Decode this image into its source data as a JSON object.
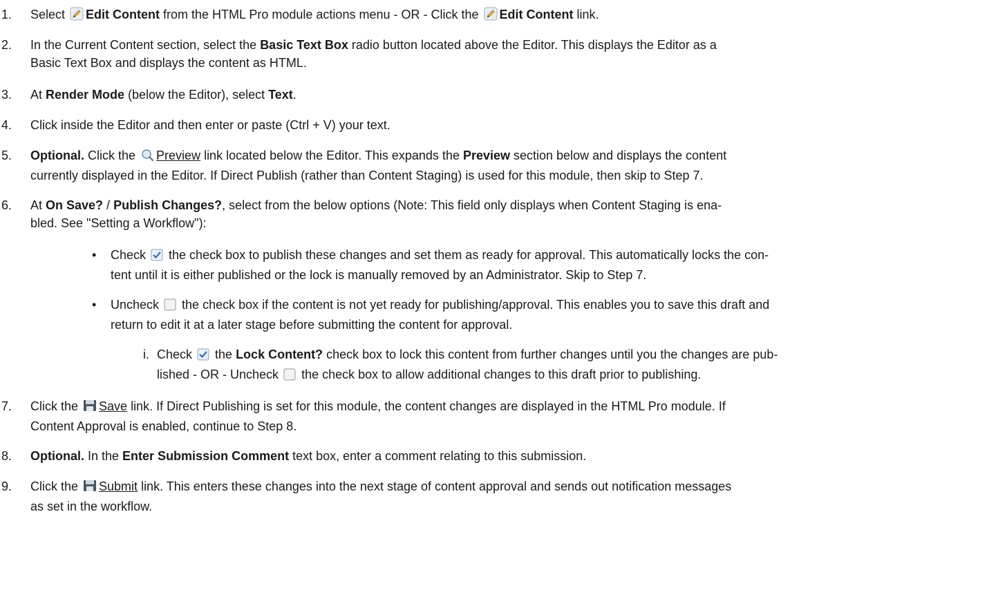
{
  "icons": {
    "edit": "pencil-edit-icon",
    "preview": "magnifier-icon",
    "checked": "checked-checkbox-icon",
    "unchecked": "unchecked-checkbox-icon",
    "save": "floppy-save-icon"
  },
  "steps": [
    {
      "num": "1.",
      "a": "Select ",
      "b": "Edit Content",
      "c": " from the HTML Pro module actions menu - OR - Click the ",
      "d": "Edit Content",
      "e": " link."
    },
    {
      "num": "2.",
      "a": "In the Current Content section, select the ",
      "b": "Basic Text Box",
      "c": " radio button located above the Editor. This displays the Editor as a",
      "line2": "Basic Text Box and displays the content as HTML."
    },
    {
      "num": "3.",
      "a": "At ",
      "b": "Render Mode",
      "c": " (below the Editor), select ",
      "d": "Text",
      "e": "."
    },
    {
      "num": "4.",
      "a": "Click inside the Editor and then enter or paste (Ctrl + V) your text."
    },
    {
      "num": "5.",
      "a": "Optional.",
      "b": " Click the ",
      "link": "Preview",
      "c": " link located below the Editor. This expands the ",
      "d": "Preview",
      "e": " section below and displays the content",
      "line2": "currently displayed in the Editor. If Direct Publish (rather than Content Staging) is used for this module, then skip to Step 7."
    },
    {
      "num": "6.",
      "a": "At ",
      "b": "On Save?",
      "c": " / ",
      "d": "Publish Changes?",
      "e": ", select from the below options (Note: This field only displays when Content Staging is ena-",
      "line2": "bled. See \"Setting a Workflow\"):"
    },
    {
      "num": "7.",
      "a": "Click the ",
      "link": "Save",
      "b": " link. If Direct Publishing is set for this module, the content changes are displayed in the HTML Pro module. If",
      "line2": "Content Approval is enabled, continue to Step 8."
    },
    {
      "num": "8.",
      "a": "Optional.",
      "b": " In the ",
      "c": "Enter Submission Comment",
      "d": " text box, enter a comment relating to this submission."
    },
    {
      "num": "9.",
      "a": "Click the ",
      "link": "Submit",
      "b": " link. This enters these changes into the next stage of content approval and sends out notification messages",
      "line2": "as set in the workflow."
    }
  ],
  "bullets": [
    {
      "a": "Check ",
      "b": " the check box to publish these changes and set them as ready for approval. This automatically locks the con-",
      "line2": "tent until it is either published or the lock is manually removed by an Administrator. Skip to Step 7."
    },
    {
      "a": "Uncheck ",
      "b": " the check box if the content is not yet ready for publishing/approval. This enables you to save this draft and",
      "line2": "return to edit it at a later stage before submitting the content for approval."
    }
  ],
  "substep": {
    "num": "i.",
    "a": "Check ",
    "b": " the ",
    "c": "Lock Content?",
    "d": " check box to lock this content from further changes until you the changes are pub-",
    "line2a": "lished - OR - Uncheck ",
    "line2b": " the check box to allow additional changes to this draft prior to publishing."
  }
}
